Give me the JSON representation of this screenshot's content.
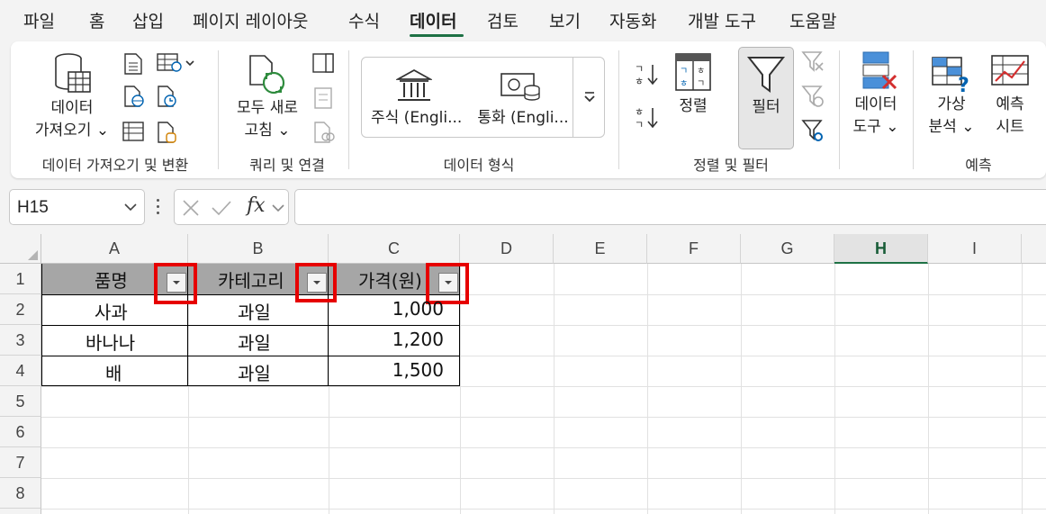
{
  "menu": {
    "tabs": [
      "파일",
      "홈",
      "삽입",
      "페이지 레이아웃",
      "수식",
      "데이터",
      "검토",
      "보기",
      "자동화",
      "개발 도구",
      "도움말"
    ],
    "active": "데이터"
  },
  "ribbon": {
    "groups": {
      "get_transform": "데이터 가져오기 및 변환",
      "queries": "쿼리 및 연결",
      "data_types": "데이터 형식",
      "sort_filter": "정렬 및 필터",
      "forecast": "예측"
    },
    "buttons": {
      "get_data_1": "데이터",
      "get_data_2": "가져오기 ⌄",
      "refresh_1": "모두 새로",
      "refresh_2": "고침 ⌄",
      "stocks": "주식 (Engli...",
      "currencies": "통화 (Engli...",
      "sort": "정렬",
      "filter": "필터",
      "data_tools_1": "데이터",
      "data_tools_2": "도구 ⌄",
      "what_if_1": "가상",
      "what_if_2": "분석 ⌄",
      "forecast_1": "예측",
      "forecast_2": "시트",
      "sort_az_top": "ㄱ",
      "sort_az_bottom": "ㅎ",
      "sort_za_top": "ㅎ",
      "sort_za_bottom": "ㄱ"
    }
  },
  "formula_bar": {
    "namebox": "H15",
    "formula": ""
  },
  "sheet": {
    "columns": [
      "A",
      "B",
      "C",
      "D",
      "E",
      "F",
      "G",
      "H",
      "I"
    ],
    "selected_column": "H",
    "rows": [
      "1",
      "2",
      "3",
      "4",
      "5",
      "6",
      "7",
      "8"
    ],
    "table": {
      "headers": [
        "품명",
        "카테고리",
        "가격(원)"
      ],
      "data": [
        [
          "사과",
          "과일",
          "1,000"
        ],
        [
          "바나나",
          "과일",
          "1,200"
        ],
        [
          "배",
          "과일",
          "1,500"
        ]
      ]
    }
  },
  "colors": {
    "accent": "#1e7145",
    "highlight": "#e60000",
    "table_header": "#a6a6a6"
  }
}
